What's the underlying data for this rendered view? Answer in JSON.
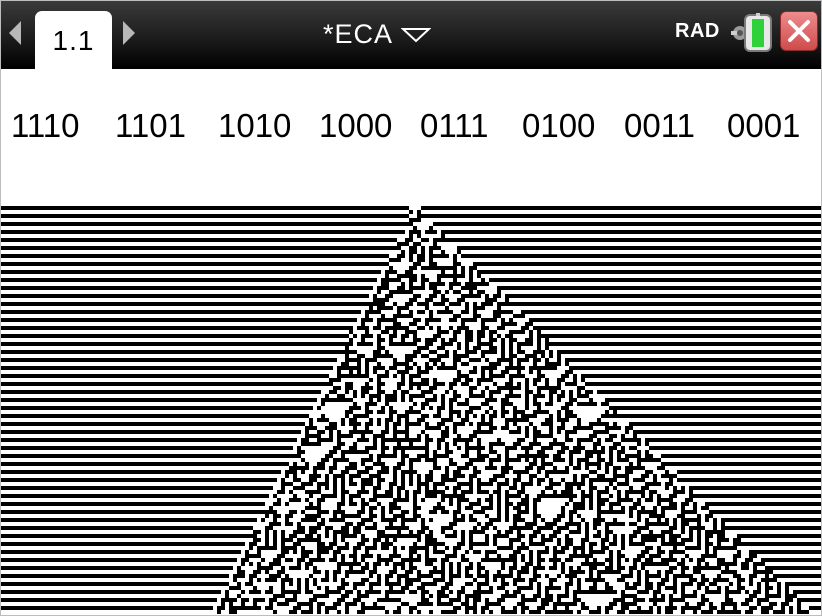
{
  "app": {
    "tab_label": "1.1",
    "document_title": "*ECA",
    "angle_mode": "RAD"
  },
  "icons": {
    "nav_left": "left-arrow-icon",
    "nav_right": "right-arrow-icon",
    "doc_menu": "chevron-down-icon",
    "battery": "battery-icon",
    "close": "close-icon"
  },
  "colors": {
    "titlebar": "#1c1c1c",
    "battery_fill": "#2fd13a",
    "close_bg": "#e06464",
    "cell_on": "#000000",
    "cell_off": "#ffffff"
  },
  "rule_codes": [
    "1110",
    "1101",
    "1010",
    "1000",
    "0111",
    "0100",
    "0011",
    "0001"
  ]
}
